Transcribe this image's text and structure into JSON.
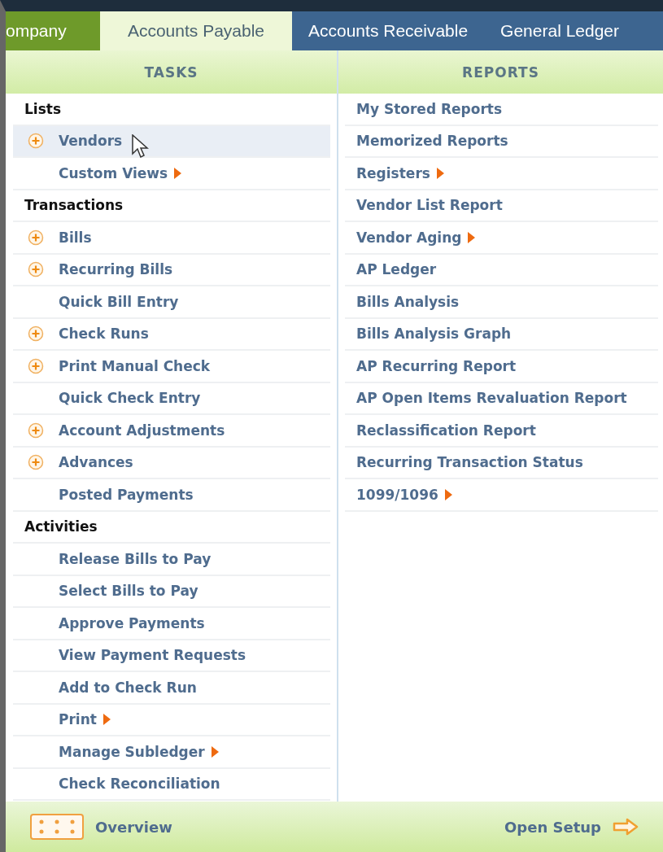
{
  "tabs": [
    {
      "label": "ompany",
      "selected": false,
      "color": "#6e9a2a"
    },
    {
      "label": "Accounts Payable",
      "selected": true,
      "color": "#eef7d8"
    },
    {
      "label": "Accounts Receivable",
      "selected": false,
      "color": "#3d6590"
    },
    {
      "label": "General Ledger",
      "selected": false,
      "color": "#3d6590"
    }
  ],
  "tasks": {
    "title": "TASKS",
    "items": [
      {
        "kind": "section",
        "label": "Lists"
      },
      {
        "kind": "item",
        "label": "Vendors",
        "plus": true,
        "submenu": false,
        "selected": true
      },
      {
        "kind": "item",
        "label": "Custom Views",
        "plus": false,
        "submenu": true,
        "selected": false
      },
      {
        "kind": "section",
        "label": "Transactions"
      },
      {
        "kind": "item",
        "label": "Bills",
        "plus": true,
        "submenu": false,
        "selected": false
      },
      {
        "kind": "item",
        "label": "Recurring Bills",
        "plus": true,
        "submenu": false,
        "selected": false
      },
      {
        "kind": "item",
        "label": "Quick Bill Entry",
        "plus": false,
        "submenu": false,
        "selected": false
      },
      {
        "kind": "item",
        "label": "Check Runs",
        "plus": true,
        "submenu": false,
        "selected": false
      },
      {
        "kind": "item",
        "label": "Print Manual Check",
        "plus": true,
        "submenu": false,
        "selected": false
      },
      {
        "kind": "item",
        "label": "Quick Check Entry",
        "plus": false,
        "submenu": false,
        "selected": false
      },
      {
        "kind": "item",
        "label": "Account Adjustments",
        "plus": true,
        "submenu": false,
        "selected": false
      },
      {
        "kind": "item",
        "label": "Advances",
        "plus": true,
        "submenu": false,
        "selected": false
      },
      {
        "kind": "item",
        "label": "Posted Payments",
        "plus": false,
        "submenu": false,
        "selected": false
      },
      {
        "kind": "section",
        "label": "Activities"
      },
      {
        "kind": "item",
        "label": "Release Bills to Pay",
        "plus": false,
        "submenu": false,
        "selected": false
      },
      {
        "kind": "item",
        "label": "Select Bills to Pay",
        "plus": false,
        "submenu": false,
        "selected": false
      },
      {
        "kind": "item",
        "label": "Approve Payments",
        "plus": false,
        "submenu": false,
        "selected": false
      },
      {
        "kind": "item",
        "label": "View Payment Requests",
        "plus": false,
        "submenu": false,
        "selected": false
      },
      {
        "kind": "item",
        "label": "Add to Check Run",
        "plus": false,
        "submenu": false,
        "selected": false
      },
      {
        "kind": "item",
        "label": "Print",
        "plus": false,
        "submenu": true,
        "selected": false
      },
      {
        "kind": "item",
        "label": "Manage Subledger",
        "plus": false,
        "submenu": true,
        "selected": false
      },
      {
        "kind": "item",
        "label": "Check Reconciliation",
        "plus": false,
        "submenu": false,
        "selected": false
      }
    ]
  },
  "reports": {
    "title": "REPORTS",
    "items": [
      {
        "label": "My Stored Reports",
        "submenu": false
      },
      {
        "label": "Memorized Reports",
        "submenu": false
      },
      {
        "label": "Registers",
        "submenu": true
      },
      {
        "label": "Vendor List Report",
        "submenu": false
      },
      {
        "label": "Vendor Aging",
        "submenu": true
      },
      {
        "label": "AP Ledger",
        "submenu": false
      },
      {
        "label": "Bills Analysis",
        "submenu": false
      },
      {
        "label": "Bills Analysis Graph",
        "submenu": false
      },
      {
        "label": "AP Recurring Report",
        "submenu": false
      },
      {
        "label": "AP Open Items Revaluation Report",
        "submenu": false
      },
      {
        "label": "Reclassification Report",
        "submenu": false
      },
      {
        "label": "Recurring Transaction Status",
        "submenu": false
      },
      {
        "label": "1099/1096",
        "submenu": true
      }
    ]
  },
  "footer": {
    "overview": "Overview",
    "setup": "Open Setup"
  }
}
